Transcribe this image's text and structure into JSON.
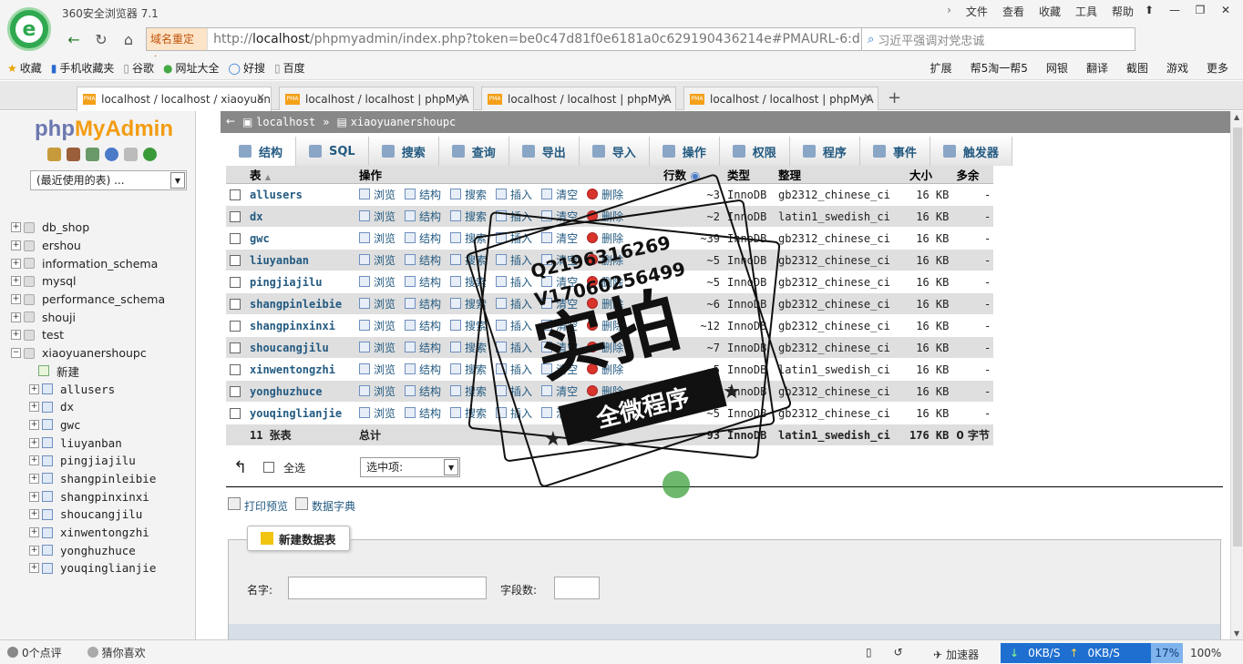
{
  "browser": {
    "title": "360安全浏览器 7.1",
    "menu": [
      "文件",
      "查看",
      "收藏",
      "工具",
      "帮助"
    ],
    "redirect_label": "域名重定向",
    "url_host": "localhost",
    "url_prefix": "http://",
    "url_rest": "/phpmyadmin/index.php?token=be0c47d81f0e6181a0c629190436214e#PMAURL-6:db_structure.",
    "search_text": "习近平强调对党忠诚"
  },
  "bookmarks": {
    "left": [
      "收藏",
      "手机收藏夹",
      "谷歌",
      "网址大全",
      "好搜",
      "百度"
    ],
    "right": [
      "扩展",
      "帮5淘一帮5",
      "网银",
      "翻译",
      "截图",
      "游戏",
      "更多"
    ]
  },
  "tabs": [
    {
      "label": "localhost / localhost / xiaoyuan"
    },
    {
      "label": "localhost / localhost | phpMyA"
    },
    {
      "label": "localhost / localhost | phpMyA"
    },
    {
      "label": "localhost / localhost | phpMyA"
    }
  ],
  "sidebar": {
    "logo_php": "php",
    "logo_myadmin": "MyAdmin",
    "recent_label": "(最近使用的表) ...",
    "databases": [
      "db_shop",
      "ershou",
      "information_schema",
      "mysql",
      "performance_schema",
      "shouji",
      "test",
      "xiaoyuanershoupc"
    ],
    "new_label": "新建",
    "tables": [
      "allusers",
      "dx",
      "gwc",
      "liuyanban",
      "pingjiajilu",
      "shangpinleibie",
      "shangpinxinxi",
      "shoucangjilu",
      "xinwentongzhi",
      "yonghuzhuce",
      "youqinglianjie"
    ]
  },
  "breadcrumb": {
    "server": "localhost",
    "database": "xiaoyuanershoupc"
  },
  "main_tabs": [
    "结构",
    "SQL",
    "搜索",
    "查询",
    "导出",
    "导入",
    "操作",
    "权限",
    "程序",
    "事件",
    "触发器"
  ],
  "table_headers": {
    "table": "表",
    "action": "操作",
    "rows": "行数",
    "type": "类型",
    "collation": "整理",
    "size": "大小",
    "overhead": "多余"
  },
  "actions": {
    "browse": "浏览",
    "structure": "结构",
    "search": "搜索",
    "insert": "插入",
    "empty": "清空",
    "drop": "删除"
  },
  "rows": [
    {
      "name": "allusers",
      "rows": "~3",
      "type": "InnoDB",
      "collation": "gb2312_chinese_ci",
      "size": "16 KB",
      "overhead": "-"
    },
    {
      "name": "dx",
      "rows": "~2",
      "type": "InnoDB",
      "collation": "latin1_swedish_ci",
      "size": "16 KB",
      "overhead": "-"
    },
    {
      "name": "gwc",
      "rows": "~39",
      "type": "InnoDB",
      "collation": "gb2312_chinese_ci",
      "size": "16 KB",
      "overhead": "-"
    },
    {
      "name": "liuyanban",
      "rows": "~5",
      "type": "InnoDB",
      "collation": "gb2312_chinese_ci",
      "size": "16 KB",
      "overhead": "-"
    },
    {
      "name": "pingjiajilu",
      "rows": "~5",
      "type": "InnoDB",
      "collation": "gb2312_chinese_ci",
      "size": "16 KB",
      "overhead": "-"
    },
    {
      "name": "shangpinleibie",
      "rows": "~6",
      "type": "InnoDB",
      "collation": "gb2312_chinese_ci",
      "size": "16 KB",
      "overhead": "-"
    },
    {
      "name": "shangpinxinxi",
      "rows": "~12",
      "type": "InnoDB",
      "collation": "gb2312_chinese_ci",
      "size": "16 KB",
      "overhead": "-"
    },
    {
      "name": "shoucangjilu",
      "rows": "~7",
      "type": "InnoDB",
      "collation": "gb2312_chinese_ci",
      "size": "16 KB",
      "overhead": "-"
    },
    {
      "name": "xinwentongzhi",
      "rows": "~5",
      "type": "InnoDB",
      "collation": "latin1_swedish_ci",
      "size": "16 KB",
      "overhead": "-"
    },
    {
      "name": "yonghuzhuce",
      "rows": "~4",
      "type": "InnoDB",
      "collation": "gb2312_chinese_ci",
      "size": "16 KB",
      "overhead": "-"
    },
    {
      "name": "youqinglianjie",
      "rows": "~5",
      "type": "InnoDB",
      "collation": "gb2312_chinese_ci",
      "size": "16 KB",
      "overhead": "-"
    }
  ],
  "summary": {
    "count": "11 张表",
    "label": "总计",
    "rows": "93",
    "type": "InnoDB",
    "collation": "latin1_swedish_ci",
    "size": "176 KB",
    "overhead": "0 字节"
  },
  "selection": {
    "check_all": "全选",
    "with_selected": "选中项:"
  },
  "links": {
    "print": "打印预览",
    "dictionary": "数据字典"
  },
  "create": {
    "button": "新建数据表",
    "name_label": "名字:",
    "fields_label": "字段数:"
  },
  "watermark": {
    "qq1": "Q2196316269",
    "qq2": "V17060256499",
    "big": "实拍",
    "band": "全微程序"
  },
  "statusbar": {
    "reviews": "0个点评",
    "guess": "猜你喜欢",
    "accelerator": "加速器",
    "down_speed": "0KB/S",
    "up_speed": "0KB/S",
    "cpu": "17%",
    "zoom": "100%"
  }
}
